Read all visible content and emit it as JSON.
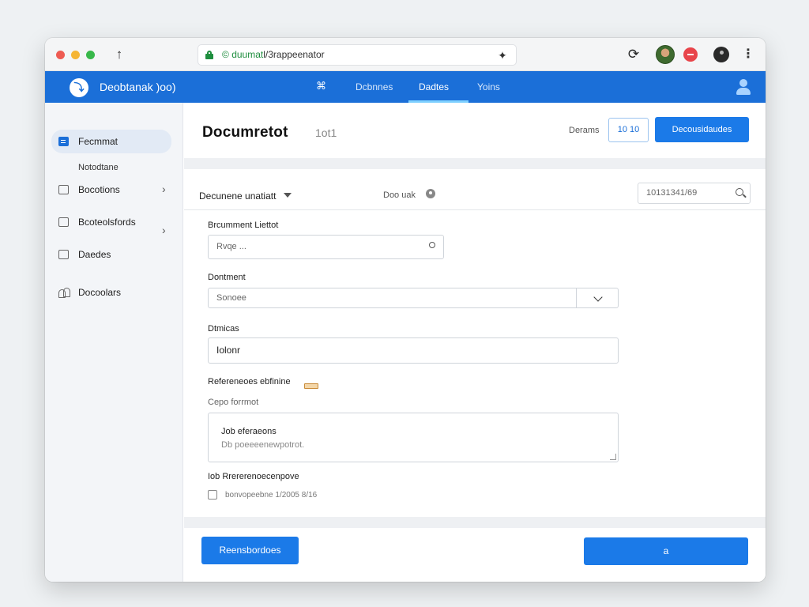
{
  "browser": {
    "url_prefix": "© ",
    "url_host": "duumat",
    "url_path": "l/3rappeenator",
    "ext_icon": "ext-icon"
  },
  "app": {
    "title": "Deobtanak )oo)",
    "nav": [
      {
        "label": "Dcbnnes",
        "active": false
      },
      {
        "label": "Dadtes",
        "active": true
      },
      {
        "label": "Yoins",
        "active": false
      }
    ]
  },
  "sidebar": {
    "items": [
      {
        "label": "Fecmmat",
        "active": true,
        "icon": "document-icon"
      },
      {
        "label": "Bocotions",
        "icon": "box-icon",
        "chevron": true
      },
      {
        "label": "Bcoteolsfords",
        "icon": "image-icon",
        "chevron": true
      },
      {
        "label": "Daedes",
        "icon": "box-icon"
      },
      {
        "label": "Docoolars",
        "icon": "people-icon"
      }
    ],
    "sub_label": "Notodtane"
  },
  "page": {
    "title": "Documretot",
    "count": "1ot1",
    "header_text": "Derams",
    "outline_button": "10 10",
    "primary_button": "Decousidaudes"
  },
  "toolbar": {
    "doc_select": "Decunene unatiatt",
    "status_text": "Doo uak",
    "search_value": "10131341/69"
  },
  "form": {
    "field1_label": "Brcumment Liettot",
    "field1_value": "Rvqe ...",
    "field2_label": "Dontment",
    "field2_value": "Sonoee",
    "field3_label": "Dtmicas",
    "field3_value": "Iolonr",
    "refs_label": "Refereneoes ebfinine",
    "refs_sub": "Cepo forrmot",
    "textarea_line1": "Job eferaeons",
    "textarea_line2": "Db poeeeenewpotrot.",
    "option_label": "Iob Rrererenoecenpove",
    "checkbox_label": "bonvopeebne 1/2005 8/16"
  },
  "footer": {
    "left_button": "Reensbordoes",
    "right_button": "а"
  },
  "colors": {
    "primary": "#1b7ae8",
    "appbar": "#1b6fd8",
    "sidebar_bg": "#f3f5f8"
  }
}
